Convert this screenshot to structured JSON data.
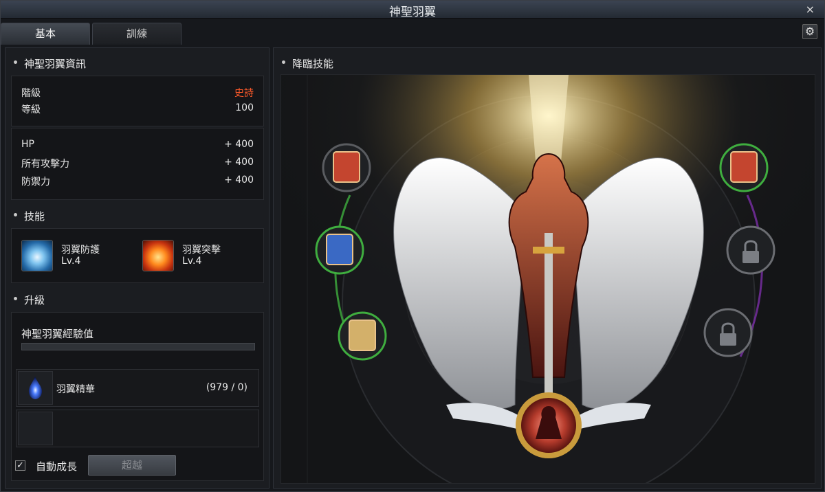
{
  "window": {
    "title": "神聖羽翼",
    "close_glyph": "×"
  },
  "tabs": [
    {
      "label": "基本"
    },
    {
      "label": "訓練"
    }
  ],
  "info": {
    "title": "神聖羽翼資訊",
    "rank_label": "階級",
    "rank_value": "史詩",
    "level_label": "等級",
    "level_value": "100"
  },
  "stats": [
    {
      "label": "HP",
      "value": "+ 400"
    },
    {
      "label": "所有攻擊力",
      "value": "+ 400"
    },
    {
      "label": "防禦力",
      "value": "+ 400"
    }
  ],
  "skills": {
    "title": "技能",
    "items": [
      {
        "name": "羽翼防護",
        "level": "Lv.4"
      },
      {
        "name": "羽翼突擊",
        "level": "Lv.4"
      }
    ]
  },
  "upgrade": {
    "title": "升級",
    "exp_label": "神聖羽翼經驗值",
    "exp_fraction": 0,
    "material_name": "羽翼精華",
    "material_count": "(979 / 0)",
    "auto_grow_label": "自動成長",
    "exceed_button": "超越"
  },
  "descend": {
    "title": "降臨技能"
  },
  "colors": {
    "epic": "#ff5a2a",
    "accent_green": "#3fae3f",
    "accent_purple": "#7a2ea8"
  },
  "icons": [
    "gear-icon",
    "close-icon",
    "lock-icon",
    "wing-guard-icon",
    "wing-strike-icon",
    "essence-icon"
  ]
}
